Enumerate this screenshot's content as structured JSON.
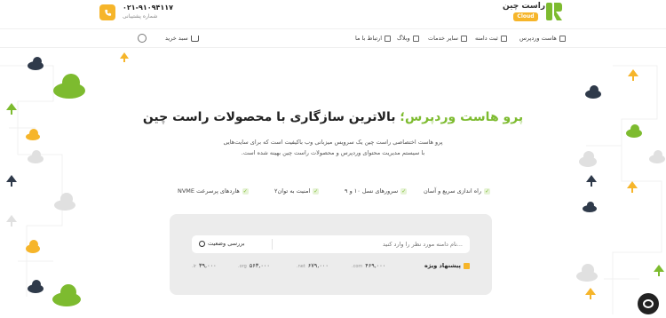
{
  "topbar": {
    "phone_number": "۰۲۱-۹۱۰۹۴۱۱۷",
    "phone_caption": "شماره پشتیبانی"
  },
  "logo": {
    "name": "راست چین",
    "badge": "Cloud"
  },
  "nav": {
    "items": [
      {
        "label": "هاست وردپرس",
        "icon": "server-icon"
      },
      {
        "label": "ثبت دامنه",
        "icon": "globe-icon"
      },
      {
        "label": "سایر خدمات",
        "icon": "grid-icon"
      },
      {
        "label": "وبلاگ",
        "icon": "blog-icon"
      },
      {
        "label": "ارتباط با ما",
        "icon": "phone-icon"
      }
    ],
    "cart_label": "سبد خرید"
  },
  "hero": {
    "title_accent": "پرو هاست وردپرس؛",
    "title_rest": " بالاترین سازگاری با محصولات راست چین",
    "description_line1": "پرو هاست اختصاصی راست چین یک سرویس میزبانی وب باکیفیت است که برای سایت‌هایی",
    "description_line2": "با سیستم مدیریت محتوای وردپرس و محصولات راست چین بهینه شده است."
  },
  "features": [
    "راه اندازی سریع و آسان",
    "سرورهای نسل ۱۰ و ۹",
    "امنیت به توان۲",
    "هاردهای پرسرعت NVME"
  ],
  "search": {
    "placeholder": "...نام دامنه مورد نظر را وارد کنید",
    "button_label": "بررسی وضعیت"
  },
  "offers": {
    "label": "پیشنهاد ویژه",
    "prices": [
      {
        "tld": ".com",
        "price": "۴۶۹,۰۰۰"
      },
      {
        "tld": ".net",
        "price": "۶۷۹,۰۰۰"
      },
      {
        "tld": ".org",
        "price": "۵۶۳,۰۰۰"
      },
      {
        "tld": ".ir",
        "price": "۳۹,۰۰۰"
      }
    ]
  },
  "colors": {
    "accent_green": "#7dbb2f",
    "accent_yellow": "#f6b52a",
    "dark": "#2f3a4a"
  }
}
